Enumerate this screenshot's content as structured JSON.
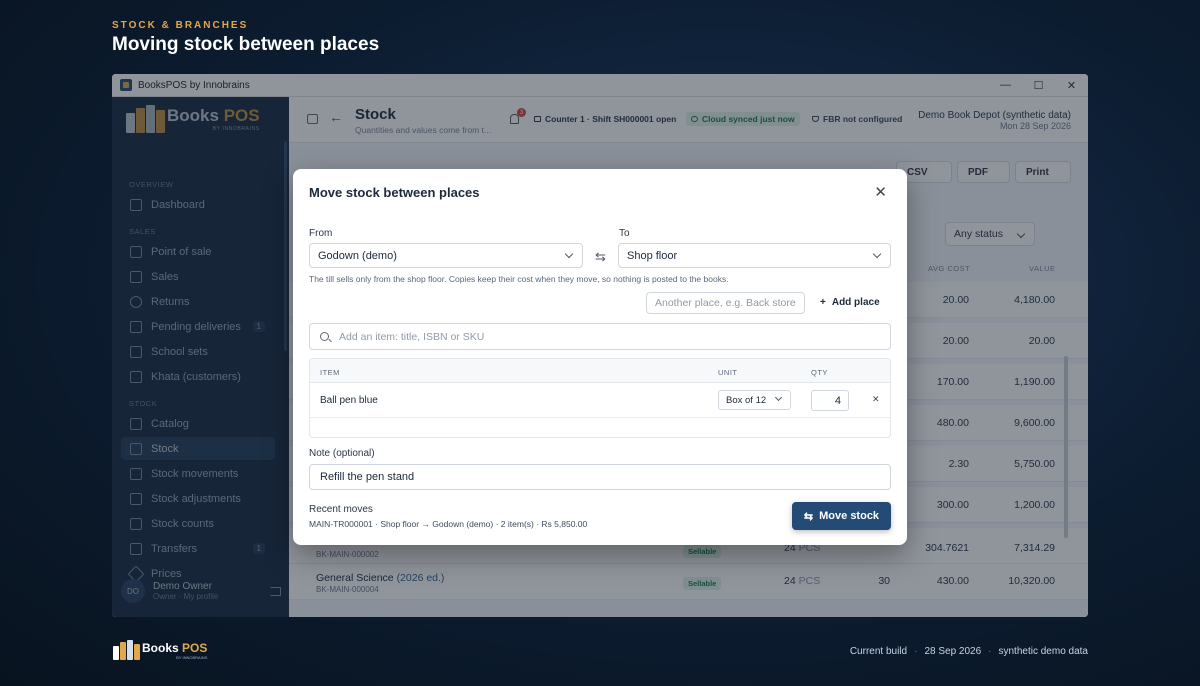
{
  "page": {
    "eyebrow": "STOCK & BRANCHES",
    "headline": "Moving stock between places"
  },
  "window": {
    "title": "BooksPOS by Innobrains",
    "controls": [
      "—",
      "☐",
      "✕"
    ]
  },
  "brand": {
    "name": "Books",
    "accent": "POS",
    "tagline": "BY INNOBRAINS"
  },
  "sidebar": {
    "sections": [
      {
        "label": "OVERVIEW",
        "items": [
          {
            "label": "Dashboard",
            "icon": "dashboard-icon"
          }
        ]
      },
      {
        "label": "SALES",
        "items": [
          {
            "label": "Point of sale",
            "icon": "pos-icon"
          },
          {
            "label": "Sales",
            "icon": "sales-icon"
          },
          {
            "label": "Returns",
            "icon": "returns-icon"
          },
          {
            "label": "Pending deliveries",
            "icon": "hourglass-icon",
            "badge": "1"
          },
          {
            "label": "School sets",
            "icon": "school-icon"
          },
          {
            "label": "Khata (customers)",
            "icon": "people-icon"
          }
        ]
      },
      {
        "label": "STOCK",
        "items": [
          {
            "label": "Catalog",
            "icon": "catalog-icon"
          },
          {
            "label": "Stock",
            "icon": "box-icon",
            "active": true
          },
          {
            "label": "Stock movements",
            "icon": "movements-icon"
          },
          {
            "label": "Stock adjustments",
            "icon": "adjust-icon"
          },
          {
            "label": "Stock counts",
            "icon": "clipboard-icon"
          },
          {
            "label": "Transfers",
            "icon": "truck-icon",
            "badge": "1"
          },
          {
            "label": "Prices",
            "icon": "tag-icon"
          }
        ]
      }
    ],
    "user": {
      "initials": "DO",
      "name": "Demo Owner",
      "role": "Owner · My profile"
    }
  },
  "topbar": {
    "title": "Stock",
    "subtitle": "Quantities and values come from t...",
    "notification_count": "3",
    "counter": "Counter 1 · Shift SH000001 open",
    "sync": "Cloud synced just now",
    "fbr": "FBR not configured",
    "company": "Demo Book Depot (synthetic data)",
    "date": "Mon 28 Sep 2026"
  },
  "background": {
    "export_buttons": [
      "CSV",
      "PDF",
      "Print"
    ],
    "status_filter": "Any status",
    "columns": [
      "AVG COST",
      "VALUE"
    ],
    "rows": [
      {
        "avg": "20.00",
        "value": "4,180.00"
      },
      {
        "avg": "20.00",
        "value": "20.00"
      },
      {
        "avg": "170.00",
        "value": "1,190.00"
      },
      {
        "avg": "480.00",
        "value": "9,600.00"
      },
      {
        "avg": "2.30",
        "value": "5,750.00"
      },
      {
        "avg": "300.00",
        "value": "1,200.00"
      },
      {
        "sku": "BK-MAIN-000002",
        "status": "Sellable",
        "pcs": "24",
        "unit": "PCS",
        "avg": "304.7621",
        "value": "7,314.29"
      },
      {
        "name": "General Science",
        "edition": "(2026 ed.)",
        "sku": "BK-MAIN-000004",
        "status": "Sellable",
        "pcs": "24",
        "unit": "PCS",
        "qty": "30",
        "avg": "430.00",
        "value": "10,320.00"
      }
    ]
  },
  "modal": {
    "title": "Move stock between places",
    "from_label": "From",
    "from_value": "Godown (demo)",
    "to_label": "To",
    "to_value": "Shop floor",
    "hint": "The till sells only from the shop floor. Copies keep their cost when they move, so nothing is posted to the books.",
    "place_placeholder": "Another place, e.g. Back store",
    "add_place": "Add place",
    "search_placeholder": "Add an item: title, ISBN or SKU",
    "table_headers": {
      "item": "ITEM",
      "unit": "UNIT",
      "qty": "QTY"
    },
    "line": {
      "item": "Ball pen blue",
      "unit": "Box of 12",
      "qty": "4"
    },
    "note_label": "Note (optional)",
    "note_value": "Refill the pen stand",
    "recent_title": "Recent moves",
    "recent_line": "MAIN-TR000001 · Shop floor → Godown (demo) · 2 item(s) · Rs 5,850.00",
    "submit": "Move stock"
  },
  "footer": {
    "build_label": "Current build",
    "build_date": "28 Sep 2026",
    "data_note": "synthetic demo data"
  },
  "colors": {
    "accent": "#e0a84a",
    "primary": "#234b76",
    "sidebar": "#1b3049"
  }
}
